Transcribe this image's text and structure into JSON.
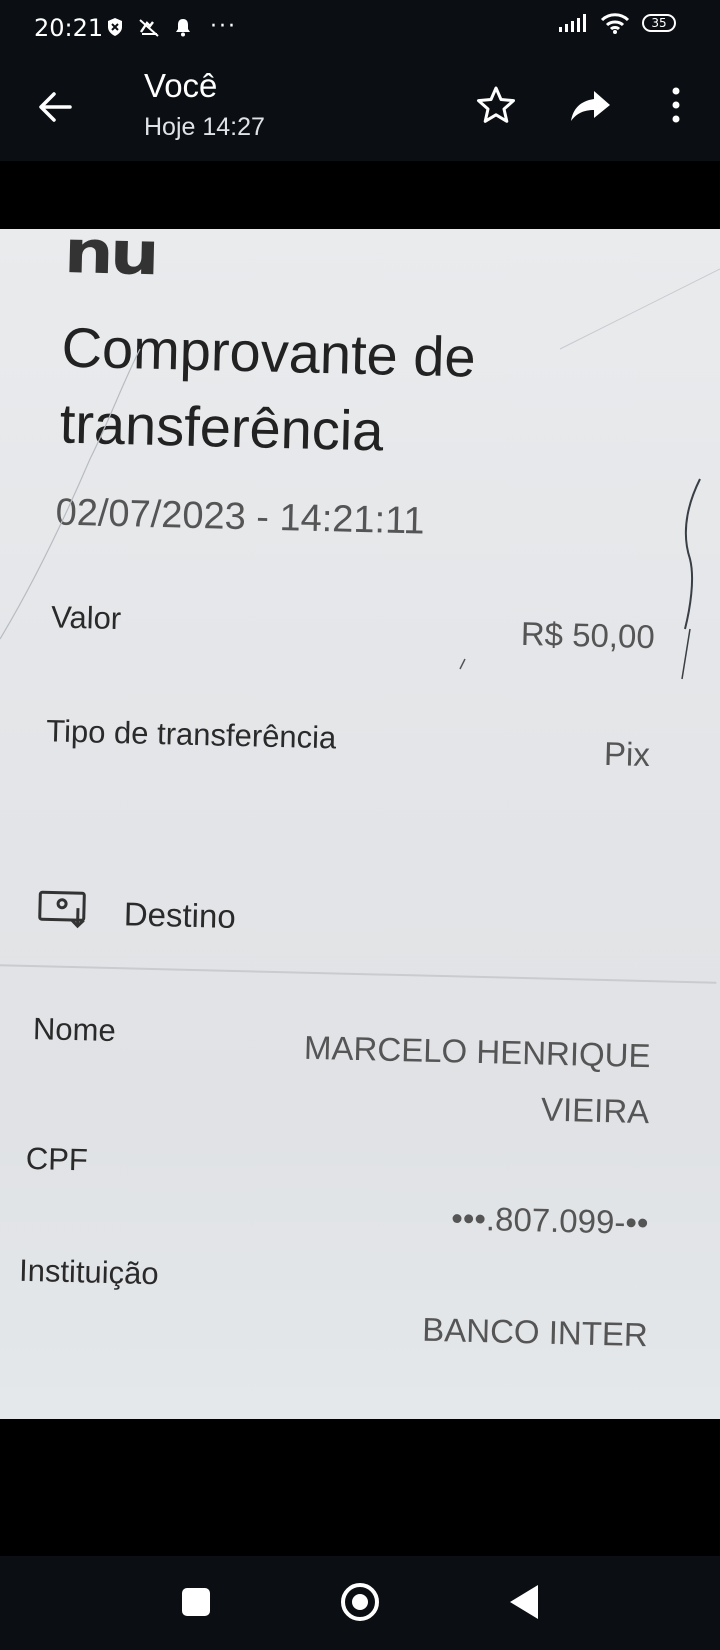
{
  "status_bar": {
    "time": "20:21",
    "more": "···",
    "battery": "35"
  },
  "app_bar": {
    "title": "Você",
    "subtitle": "Hoje 14:27"
  },
  "receipt": {
    "logo": "nu",
    "title": "Comprovante de transferência",
    "datetime": "02/07/2023 - 14:21:11",
    "rows": [
      {
        "label": "Valor",
        "value": "R$ 50,00"
      },
      {
        "label": "Tipo de transferência",
        "value": "Pix"
      }
    ],
    "section_title": "Destino",
    "destino_rows": [
      {
        "label": "Nome",
        "value": "MARCELO HENRIQUE VIEIRA"
      },
      {
        "label": "CPF",
        "value": "•••.807.099-••"
      },
      {
        "label": "Instituição",
        "value": "BANCO INTER"
      }
    ]
  },
  "icons": {
    "back": "arrow-left-icon",
    "star": "star-outline-icon",
    "share": "share-arrow-icon",
    "more": "more-vertical-icon",
    "destino": "receive-money-icon"
  },
  "colors": {
    "bar_bg": "#0b0f14",
    "photo_bg": "#e6e8ea",
    "text_dark": "#2b2d31"
  }
}
